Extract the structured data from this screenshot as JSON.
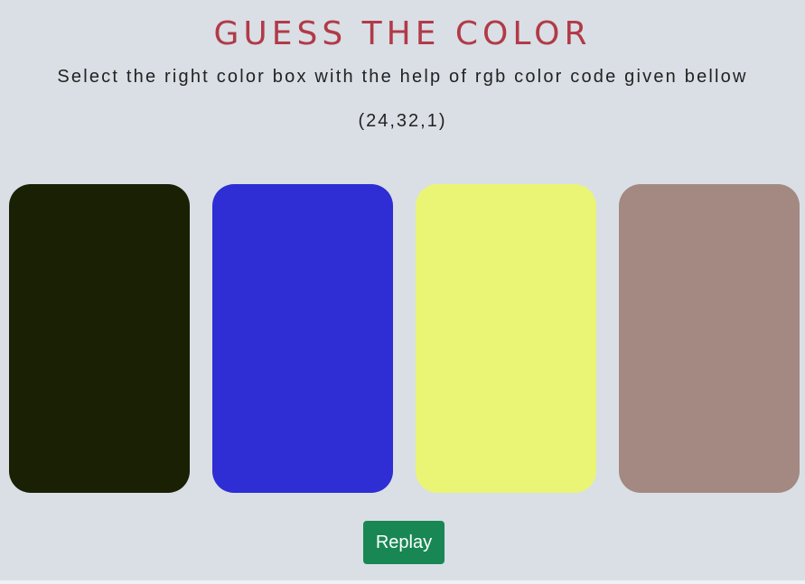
{
  "header": {
    "title": "GUESS THE COLOR",
    "subtitle": "Select the right color box with the help of rgb color code given bellow",
    "rgb_code": "(24,32,1)"
  },
  "boxes": [
    {
      "color": "#1a2004"
    },
    {
      "color": "#2f2dd4"
    },
    {
      "color": "#eaf575"
    },
    {
      "color": "#a38982"
    }
  ],
  "controls": {
    "replay_label": "Replay",
    "replay_color": "#198754"
  },
  "theme": {
    "background": "#d9dfe5",
    "title_color": "#b23a48"
  }
}
